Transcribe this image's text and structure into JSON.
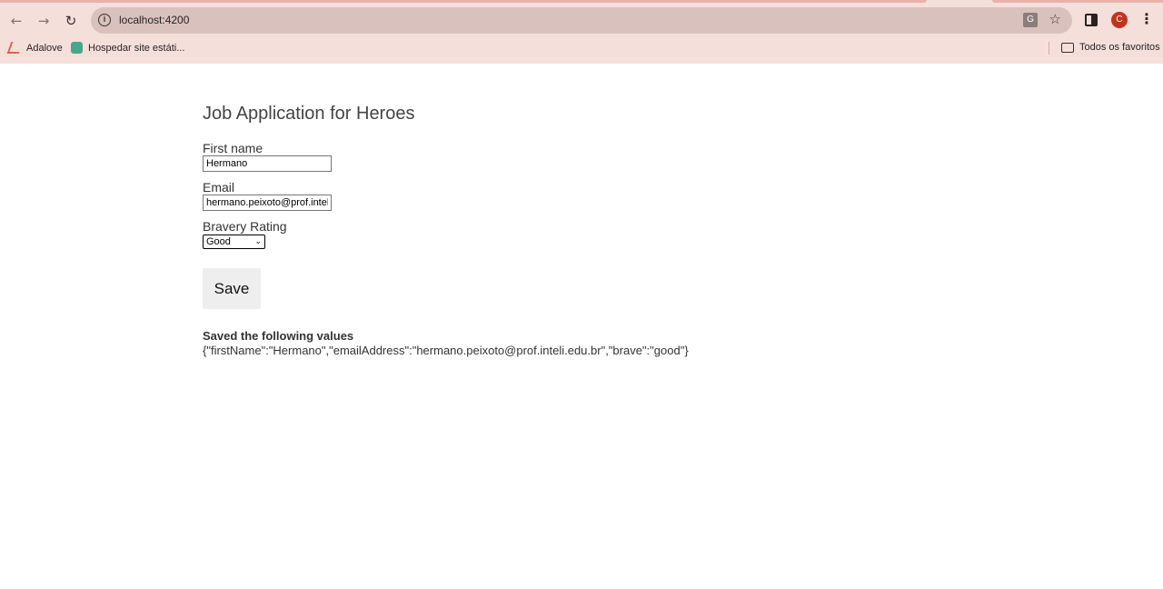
{
  "browser": {
    "url": "localhost:4200",
    "profile_initial": "C",
    "bookmarks": [
      {
        "label": "Adalove",
        "icon": "adalove-icon"
      },
      {
        "label": "Hospedar site estáti...",
        "icon": "site-icon"
      }
    ],
    "all_bookmarks_label": "Todos os favoritos"
  },
  "page": {
    "title": "Job Application for Heroes",
    "first_name_label": "First name",
    "first_name_value": "Hermano",
    "email_label": "Email",
    "email_value": "hermano.peixoto@prof.inteli.edu.br",
    "bravery_label": "Bravery Rating",
    "bravery_selected": "Good",
    "save_label": "Save",
    "saved_heading": "Saved the following values",
    "saved_json": "{\"firstName\":\"Hermano\",\"emailAddress\":\"hermano.peixoto@prof.inteli.edu.br\",\"brave\":\"good\"}"
  }
}
